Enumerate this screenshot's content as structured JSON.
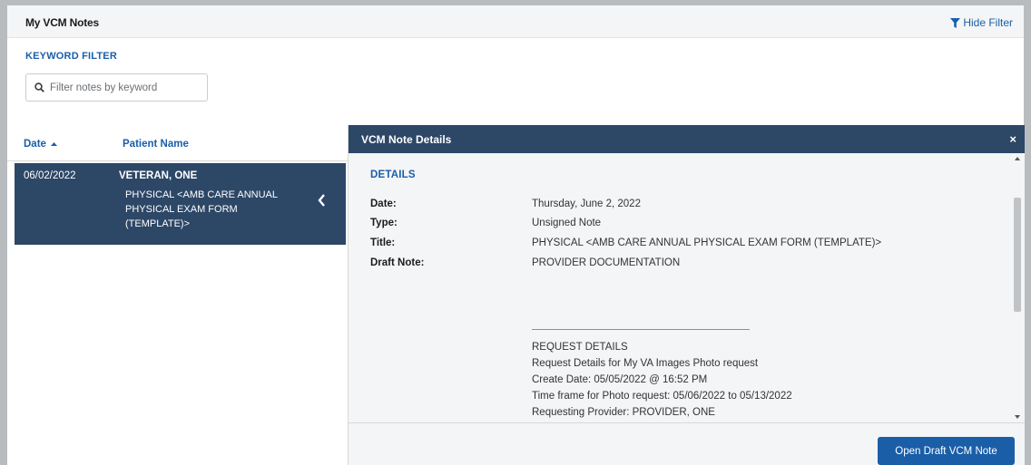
{
  "app": {
    "title": "My VCM Notes",
    "hide_filter_label": "Hide Filter"
  },
  "filter": {
    "section_label": "KEYWORD FILTER",
    "placeholder": "Filter notes by keyword",
    "value": ""
  },
  "list": {
    "columns": {
      "date": "Date",
      "date_sort": "ascending",
      "patient": "Patient Name"
    },
    "rows": [
      {
        "date": "06/02/2022",
        "patient": "VETERAN, ONE",
        "title": "PHYSICAL <AMB CARE ANNUAL PHYSICAL EXAM FORM (TEMPLATE)>",
        "selected": true
      }
    ]
  },
  "details": {
    "header": "VCM Note Details",
    "close_label": "×",
    "section_title": "DETAILS",
    "fields": [
      {
        "label": "Date:",
        "value": "Thursday, June 2, 2022"
      },
      {
        "label": "Type:",
        "value": "Unsigned Note"
      },
      {
        "label": "Title:",
        "value": "PHYSICAL <AMB CARE ANNUAL PHYSICAL EXAM FORM (TEMPLATE)>"
      },
      {
        "label": "Draft Note:",
        "value": "PROVIDER DOCUMENTATION"
      }
    ],
    "request_lines": [
      "REQUEST DETAILS",
      "Request Details for My VA Images Photo request",
      "Create Date: 05/05/2022 @ 16:52 PM",
      "Time frame for Photo request: 05/06/2022 to 05/13/2022",
      "Requesting Provider:  PROVIDER, ONE"
    ],
    "open_button_label": "Open Draft VCM Note"
  },
  "colors": {
    "accent": "#1a5ea8",
    "header_navy": "#2d4767",
    "panel_bg": "#f4f5f6"
  }
}
